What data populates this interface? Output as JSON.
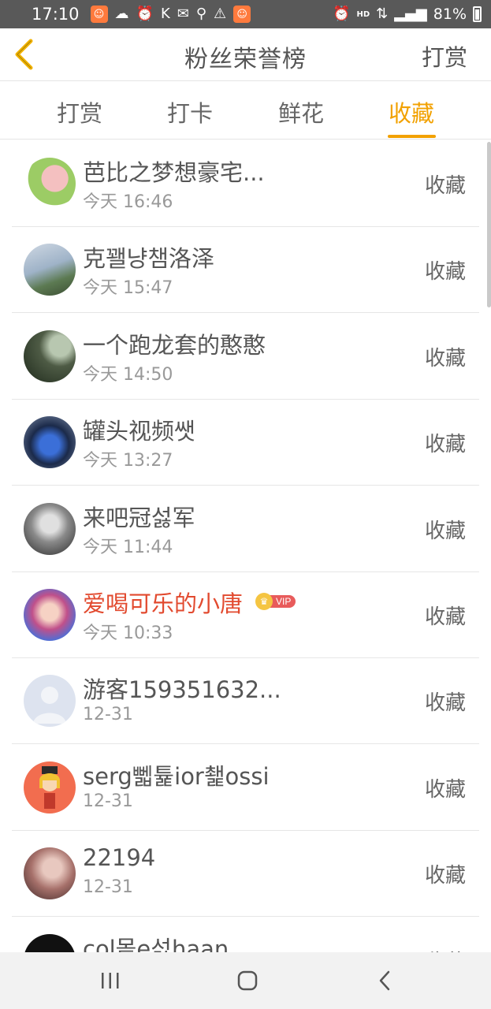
{
  "status_bar": {
    "time": "17:10",
    "battery": "81%",
    "hd": "HD",
    "icons": [
      "app-notification-icon",
      "weather-icon",
      "alarm-icon",
      "k-app-icon",
      "mail-icon",
      "pin-icon",
      "warning-icon",
      "app-notification-icon",
      "alarm-icon",
      "data-icon",
      "signal-icon",
      "battery-icon"
    ]
  },
  "header": {
    "title": "粉丝荣誉榜",
    "action": "打赏"
  },
  "tabs": [
    {
      "label": "打赏",
      "active": false
    },
    {
      "label": "打卡",
      "active": false
    },
    {
      "label": "鲜花",
      "active": false
    },
    {
      "label": "收藏",
      "active": true
    }
  ],
  "colors": {
    "accent": "#f2a100",
    "vip_name": "#e24a2f",
    "text": "#555555",
    "subtext": "#999999"
  },
  "list": [
    {
      "name": "芭比之梦想豪宅...",
      "time": "今天 16:46",
      "status": "收藏",
      "vip": false
    },
    {
      "name": "克꽬냥챔洛泽",
      "time": "今天 15:47",
      "status": "收藏",
      "vip": false
    },
    {
      "name": "一个跑龙套的憨憨",
      "time": "今天 14:50",
      "status": "收藏",
      "vip": false
    },
    {
      "name": "罐头视频쌧",
      "time": "今天 13:27",
      "status": "收藏",
      "vip": false
    },
    {
      "name": "来吧冠섫军",
      "time": "今天 11:44",
      "status": "收藏",
      "vip": false
    },
    {
      "name": "爱喝可乐的小唐",
      "time": "今天 10:33",
      "status": "收藏",
      "vip": true,
      "vip_label": "VIP"
    },
    {
      "name": "游客159351632...",
      "time": "12-31",
      "status": "收藏",
      "vip": false
    },
    {
      "name": "serg뻷튩ior쵍ossi",
      "time": "12-31",
      "status": "收藏",
      "vip": false
    },
    {
      "name": "22194",
      "time": "12-31",
      "status": "收藏",
      "vip": false
    },
    {
      "name": "col뫁e섟haan",
      "time": "",
      "status": "收藏",
      "vip": false
    }
  ]
}
